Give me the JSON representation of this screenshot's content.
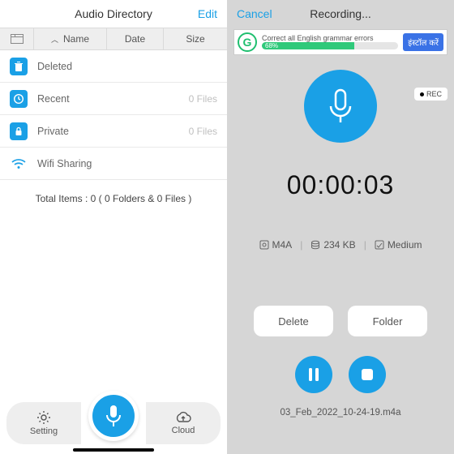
{
  "left": {
    "title": "Audio Directory",
    "edit": "Edit",
    "header": {
      "name": "Name",
      "date": "Date",
      "size": "Size"
    },
    "rows": [
      {
        "label": "Deleted",
        "count": ""
      },
      {
        "label": "Recent",
        "count": "0 Files"
      },
      {
        "label": "Private",
        "count": "0 Files"
      },
      {
        "label": "Wifi Sharing",
        "count": ""
      }
    ],
    "total": "Total Items : 0 ( 0 Folders & 0 Files )",
    "tabs": {
      "setting": "Setting",
      "cloud": "Cloud"
    }
  },
  "right": {
    "cancel": "Cancel",
    "title": "Recording...",
    "ad": {
      "text": "Correct all English grammar errors",
      "progress": "68%",
      "cta": "इंस्टॉल करें"
    },
    "rec_badge": "REC",
    "timer": "00:00:03",
    "info": {
      "format": "M4A",
      "size": "234 KB",
      "quality": "Medium"
    },
    "buttons": {
      "delete": "Delete",
      "folder": "Folder"
    },
    "filename": "03_Feb_2022_10-24-19.m4a"
  }
}
